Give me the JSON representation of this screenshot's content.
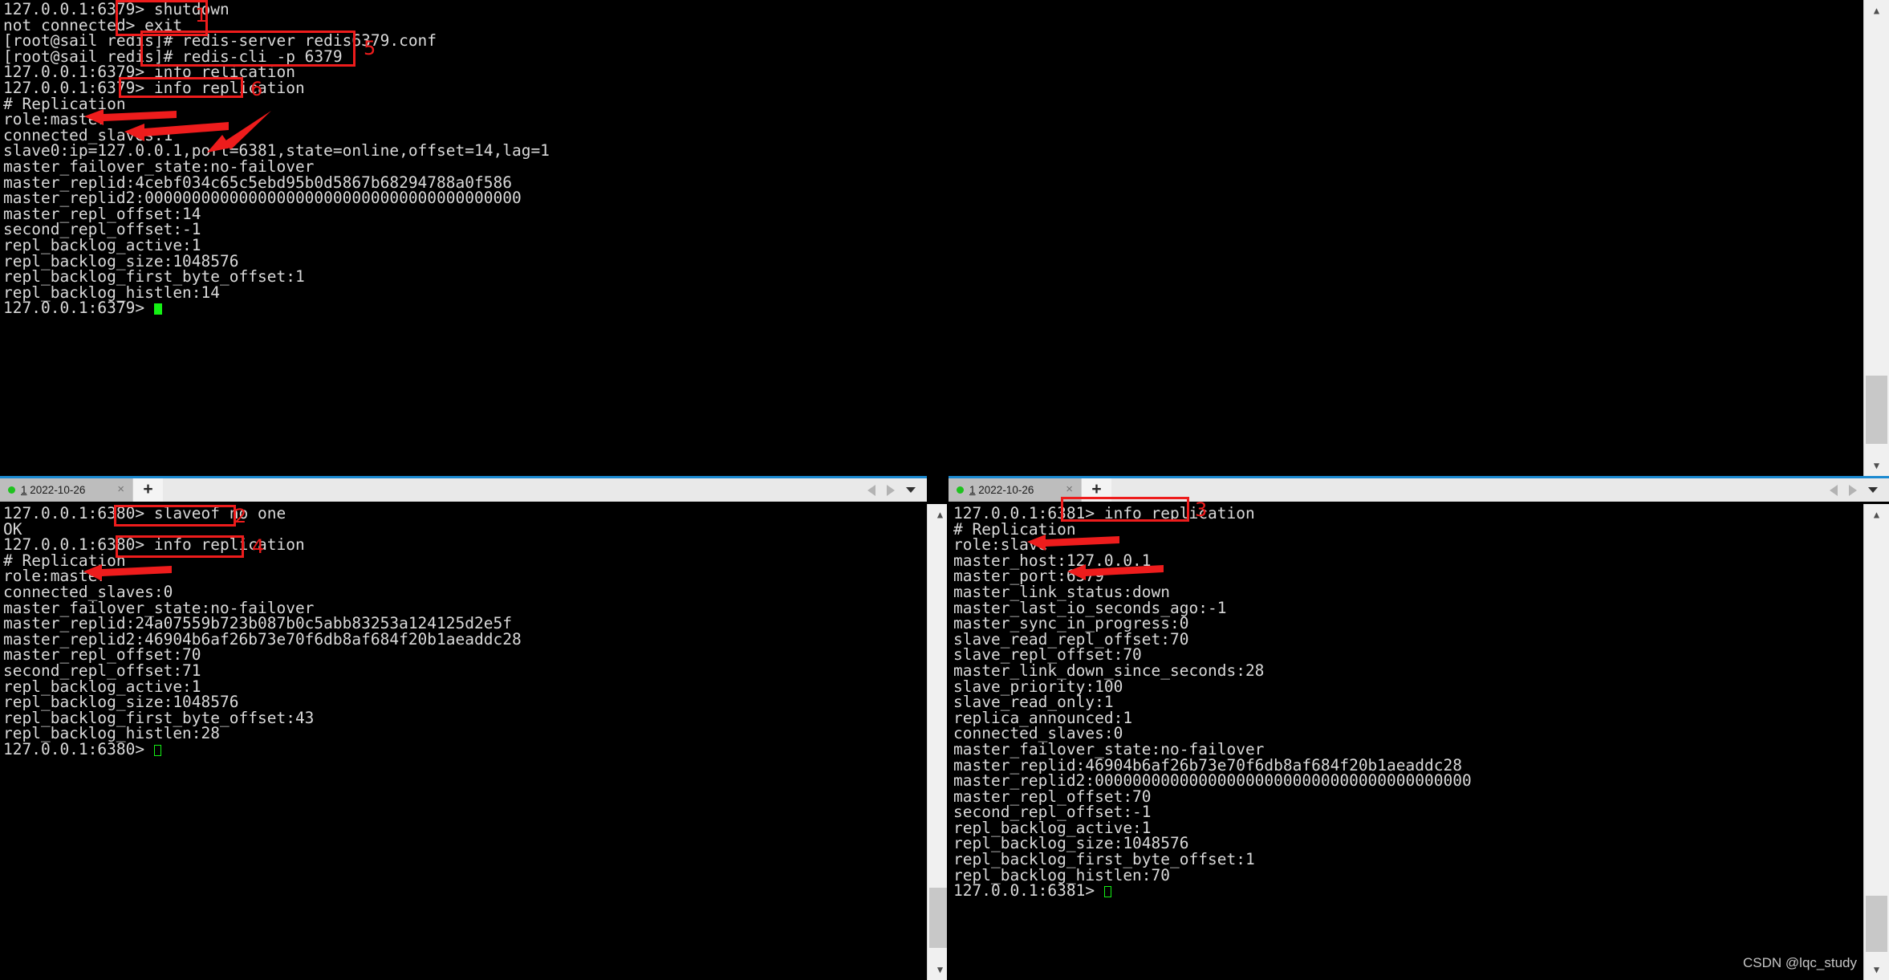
{
  "panes": {
    "top": {
      "name": "redis-6379-master-terminal",
      "lines": [
        "127.0.0.1:6379> shutdown",
        "not connected> exit",
        "[root@sail redis]# redis-server redis6379.conf",
        "[root@sail redis]# redis-cli -p 6379",
        "127.0.0.1:6379> info relication",
        "127.0.0.1:6379> info replication",
        "# Replication",
        "role:master",
        "connected_slaves:1",
        "slave0:ip=127.0.0.1,port=6381,state=online,offset=14,lag=1",
        "master_failover_state:no-failover",
        "master_replid:4cebf034c65c5ebd95b0d5867b68294788a0f586",
        "master_replid2:0000000000000000000000000000000000000000",
        "master_repl_offset:14",
        "second_repl_offset:-1",
        "repl_backlog_active:1",
        "repl_backlog_size:1048576",
        "repl_backlog_first_byte_offset:1",
        "repl_backlog_histlen:14"
      ],
      "prompt": "127.0.0.1:6379> "
    },
    "bottom_left": {
      "name": "redis-6380-terminal",
      "tab": {
        "index": "1",
        "date": "2022-10-26",
        "close_label": "×",
        "new_tab_label": "+"
      },
      "lines": [
        "127.0.0.1:6380> slaveof no one",
        "OK",
        "127.0.0.1:6380> info replication",
        "# Replication",
        "role:master",
        "connected_slaves:0",
        "master_failover_state:no-failover",
        "master_replid:24a07559b723b087b0c5abb83253a124125d2e5f",
        "master_replid2:46904b6af26b73e70f6db8af684f20b1aeaddc28",
        "master_repl_offset:70",
        "second_repl_offset:71",
        "repl_backlog_active:1",
        "repl_backlog_size:1048576",
        "repl_backlog_first_byte_offset:43",
        "repl_backlog_histlen:28"
      ],
      "prompt": "127.0.0.1:6380> "
    },
    "bottom_right": {
      "name": "redis-6381-slave-terminal",
      "tab": {
        "index": "1",
        "date": "2022-10-26",
        "close_label": "×",
        "new_tab_label": "+"
      },
      "lines": [
        "127.0.0.1:6381> info replication",
        "# Replication",
        "role:slave",
        "master_host:127.0.0.1",
        "master_port:6379",
        "master_link_status:down",
        "master_last_io_seconds_ago:-1",
        "master_sync_in_progress:0",
        "slave_read_repl_offset:70",
        "slave_repl_offset:70",
        "master_link_down_since_seconds:28",
        "slave_priority:100",
        "slave_read_only:1",
        "replica_announced:1",
        "connected_slaves:0",
        "master_failover_state:no-failover",
        "master_replid:46904b6af26b73e70f6db8af684f20b1aeaddc28",
        "master_replid2:0000000000000000000000000000000000000000",
        "master_repl_offset:70",
        "second_repl_offset:-1",
        "repl_backlog_active:1",
        "repl_backlog_size:1048576",
        "repl_backlog_first_byte_offset:1",
        "repl_backlog_histlen:70"
      ],
      "prompt": "127.0.0.1:6381> "
    }
  },
  "annotations": {
    "numbers": {
      "n1": "1",
      "n2": "2",
      "n3": "3",
      "n4": "4",
      "n5": "5",
      "n6": "6"
    },
    "highlighted_commands": {
      "box1": "shutdown / exit",
      "box5": "redis-server redis6379.conf / redis-cli -p 6379",
      "box6": "info replication",
      "box2": "slaveof no one",
      "box4": "info replication",
      "box3": "info replication"
    },
    "arrow_targets": [
      "role:master",
      "connected_slaves:1",
      "slave0:ip=127.0.0.1,port=6381",
      "role:master (6380)",
      "role:slave (6381)",
      "master_port:6379 (6381)"
    ],
    "accent_color": "#ee1c1c"
  },
  "watermark": {
    "text": "CSDN @lqc_study"
  },
  "colors": {
    "terminal_bg": "#000000",
    "terminal_fg": "#d9d9d9",
    "cursor": "#14f014",
    "tab_accent": "#1b8ad1",
    "tab_active": "#bdbdbd",
    "annotation": "#ee1c1c"
  }
}
